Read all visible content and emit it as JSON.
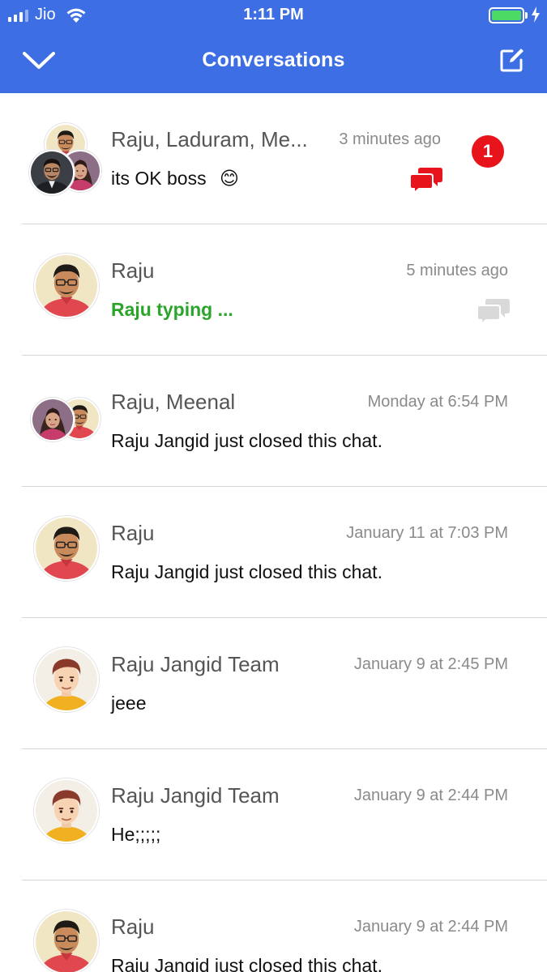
{
  "status_bar": {
    "carrier": "Jio",
    "time": "1:11 PM",
    "battery_color": "#4cd964"
  },
  "header": {
    "title": "Conversations",
    "back_icon": "chevron-down-icon",
    "compose_icon": "compose-icon",
    "background": "#3d6ee3"
  },
  "conversations": [
    {
      "name": "Raju, Laduram, Me...",
      "time": "3 minutes ago",
      "message": "its OK boss",
      "emoji": "😊",
      "unread": "1",
      "chat_icon_color": "#e8141c"
    },
    {
      "name": "Raju",
      "time": "5 minutes ago",
      "message": "Raju typing ...",
      "chat_icon_color": "#d9d9d9"
    },
    {
      "name": "Raju, Meenal",
      "time": "Monday at 6:54 PM",
      "message": "Raju Jangid just closed this chat."
    },
    {
      "name": "Raju",
      "time": "January 11 at 7:03 PM",
      "message": "Raju Jangid just closed this chat."
    },
    {
      "name": "Raju Jangid Team",
      "time": "January 9 at 2:45 PM",
      "message": "jeee"
    },
    {
      "name": "Raju Jangid Team",
      "time": "January 9 at 2:44 PM",
      "message": "He;;;;;"
    },
    {
      "name": "Raju",
      "time": "January 9 at 2:44 PM",
      "message": "Raju Jangid just closed this chat."
    }
  ]
}
